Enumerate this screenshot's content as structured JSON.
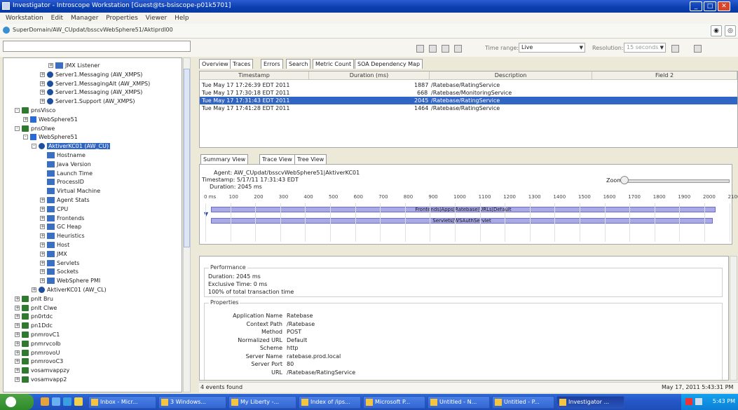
{
  "window": {
    "title": "Investigator - Introscope Workstation [Guest@ts-bsiscope-p01k5701]"
  },
  "menu": [
    "Workstation",
    "Edit",
    "Manager",
    "Properties",
    "Viewer",
    "Help"
  ],
  "path": "SuperDomain/AW_CUpdat/bsscvWebSphere51/Aktiprdl00",
  "toolbar": {
    "timerange_label": "Time range:",
    "timerange_value": "Live",
    "resolution_label": "Resolution:",
    "resolution_value": "15 seconds"
  },
  "tree": [
    {
      "indent": 5,
      "exp": "+",
      "icon": "metric",
      "label": "JMX Listener"
    },
    {
      "indent": 4,
      "exp": "+",
      "icon": "agent",
      "label": "Server1.Messaging (AW_XMPS)"
    },
    {
      "indent": 4,
      "exp": "+",
      "icon": "agent",
      "label": "Server1.MessagingAlt (AW_XMPS)"
    },
    {
      "indent": 4,
      "exp": "+",
      "icon": "agent",
      "label": "Server1.Messaging (AW_XMPS)"
    },
    {
      "indent": 4,
      "exp": "+",
      "icon": "agent",
      "label": "Server1.Support (AW_XMPS)"
    },
    {
      "indent": 1,
      "exp": "-",
      "icon": "folder",
      "label": "pnsVisco"
    },
    {
      "indent": 2,
      "exp": "+",
      "icon": "server",
      "label": "WebSphere51"
    },
    {
      "indent": 1,
      "exp": "-",
      "icon": "folder",
      "label": "pnsOlwe"
    },
    {
      "indent": 2,
      "exp": "-",
      "icon": "server",
      "label": "WebSphere51"
    },
    {
      "indent": 3,
      "exp": "-",
      "icon": "agent",
      "label": "AktiverKC01 (AW_CU)",
      "selected": true
    },
    {
      "indent": 4,
      "exp": "",
      "icon": "metric",
      "label": "Hostname"
    },
    {
      "indent": 4,
      "exp": "",
      "icon": "metric",
      "label": "Java Version"
    },
    {
      "indent": 4,
      "exp": "",
      "icon": "metric",
      "label": "Launch Time"
    },
    {
      "indent": 4,
      "exp": "",
      "icon": "metric",
      "label": "ProcessID"
    },
    {
      "indent": 4,
      "exp": "",
      "icon": "metric",
      "label": "Virtual Machine"
    },
    {
      "indent": 4,
      "exp": "+",
      "icon": "metric",
      "label": "Agent Stats"
    },
    {
      "indent": 4,
      "exp": "+",
      "icon": "metric",
      "label": "CPU"
    },
    {
      "indent": 4,
      "exp": "+",
      "icon": "metric",
      "label": "Frontends"
    },
    {
      "indent": 4,
      "exp": "+",
      "icon": "metric",
      "label": "GC Heap"
    },
    {
      "indent": 4,
      "exp": "+",
      "icon": "metric",
      "label": "Heuristics"
    },
    {
      "indent": 4,
      "exp": "+",
      "icon": "metric",
      "label": "Host"
    },
    {
      "indent": 4,
      "exp": "+",
      "icon": "metric",
      "label": "JMX"
    },
    {
      "indent": 4,
      "exp": "+",
      "icon": "metric",
      "label": "Servlets"
    },
    {
      "indent": 4,
      "exp": "+",
      "icon": "metric",
      "label": "Sockets"
    },
    {
      "indent": 4,
      "exp": "+",
      "icon": "metric",
      "label": "WebSphere PMI"
    },
    {
      "indent": 3,
      "exp": "+",
      "icon": "agent",
      "label": "AktiverKC01 (AW_CL)"
    },
    {
      "indent": 1,
      "exp": "+",
      "icon": "folder",
      "label": "pnlt Bru"
    },
    {
      "indent": 1,
      "exp": "+",
      "icon": "folder",
      "label": "pnlt Clwe"
    },
    {
      "indent": 1,
      "exp": "+",
      "icon": "folder",
      "label": "pn0rtdc"
    },
    {
      "indent": 1,
      "exp": "+",
      "icon": "folder",
      "label": "pn1Ddc"
    },
    {
      "indent": 1,
      "exp": "+",
      "icon": "folder",
      "label": "pnmrovC1"
    },
    {
      "indent": 1,
      "exp": "+",
      "icon": "folder",
      "label": "pnmrvcolb"
    },
    {
      "indent": 1,
      "exp": "+",
      "icon": "folder",
      "label": "pnmrovoU"
    },
    {
      "indent": 1,
      "exp": "+",
      "icon": "folder",
      "label": "pnmrovoC3"
    },
    {
      "indent": 1,
      "exp": "+",
      "icon": "folder",
      "label": "vosamvappzy"
    },
    {
      "indent": 1,
      "exp": "+",
      "icon": "folder",
      "label": "vosamvapp2"
    }
  ],
  "tabs_top": [
    "Overview",
    "Traces",
    "Errors",
    "Search",
    "Metric Count",
    "SOA Dependency Map"
  ],
  "trace_table": {
    "headers": [
      "Timestamp",
      "Duration (ms)",
      "Description",
      "Field 2"
    ],
    "rows": [
      {
        "ts": "Tue May 17 17:26:39 EDT 2011",
        "dur": "1887",
        "desc": "/Ratebase/RatingService"
      },
      {
        "ts": "Tue May 17 17:30:18 EDT 2011",
        "dur": "668",
        "desc": "/Ratebase/MonitoringService"
      },
      {
        "ts": "Tue May 17 17:31:43 EDT 2011",
        "dur": "2045",
        "desc": "/Ratebase/RatingService",
        "selected": true
      },
      {
        "ts": "Tue May 17 17:41:28 EDT 2011",
        "dur": "1464",
        "desc": "/Ratebase/RatingService"
      }
    ]
  },
  "tabs_bottom": [
    "Summary View",
    "Trace View",
    "Tree View"
  ],
  "trace_view": {
    "agent": "Agent: AW_CUpdat/bsscvWebSphere51|AktiverKC01",
    "timestamp": "Timestamp: 5/17/11 17:31:43 EDT",
    "duration": "Duration: 2045 ms",
    "zoom_label": "Zoom",
    "ticks": [
      "0 ms",
      "100",
      "200",
      "300",
      "400",
      "500",
      "600",
      "700",
      "800",
      "900",
      "1000",
      "1100",
      "1200",
      "1300",
      "1400",
      "1500",
      "1600",
      "1700",
      "1800",
      "1900",
      "2000",
      "2100"
    ],
    "bars": [
      "Frontends|Apps|Ratebase|URLs|Default",
      "Servlets|WSAuthServlet"
    ]
  },
  "performance": {
    "title": "Performance",
    "duration": "Duration: 2045 ms",
    "exclusive": "Exclusive Time: 0 ms",
    "pct": "100% of total transaction time"
  },
  "properties": {
    "title": "Properties",
    "rows": [
      {
        "k": "Application Name",
        "v": "Ratebase"
      },
      {
        "k": "Context Path",
        "v": "/Ratebase"
      },
      {
        "k": "Method",
        "v": "POST"
      },
      {
        "k": "Normalized URL",
        "v": "Default"
      },
      {
        "k": "Scheme",
        "v": "http"
      },
      {
        "k": "Server Name",
        "v": "ratebase.prod.local"
      },
      {
        "k": "Server Port",
        "v": "80"
      },
      {
        "k": "URL",
        "v": "/Ratebase/RatingService"
      }
    ]
  },
  "status": {
    "left": "4 events found",
    "right": "May 17, 2011 5:43:31 PM"
  },
  "taskbar": {
    "tasks": [
      "Inbox - Micr...",
      "3 Windows...",
      "My Liberty -...",
      "Index of /ips...",
      "Microsoft P...",
      "Untitled - N...",
      "Untitled - P...",
      "Investigator ..."
    ],
    "clock": "5:43 PM"
  }
}
